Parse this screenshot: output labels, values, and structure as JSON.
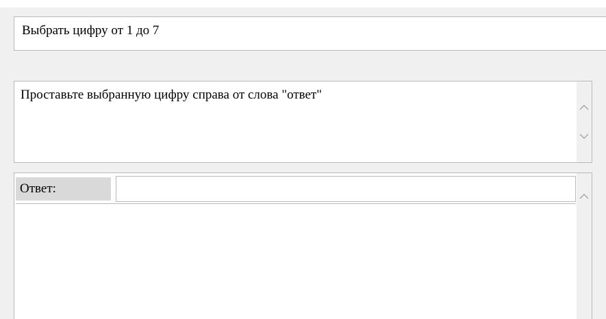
{
  "task": {
    "text": "Выбрать цифру от 1 до 7"
  },
  "instruction": {
    "text": "Проставьте выбранную цифру справа от слова \"ответ\""
  },
  "answer": {
    "label": "Ответ:",
    "value": "",
    "placeholder": ""
  },
  "icons": {
    "scroll_up": "chevron-up-icon",
    "scroll_down": "chevron-down-icon"
  },
  "colors": {
    "background": "#f0f0f0",
    "panel": "#ffffff",
    "border": "#b9b9b9",
    "label_background": "#d9d9d9",
    "scroll_arrow": "#a8a8a8"
  }
}
